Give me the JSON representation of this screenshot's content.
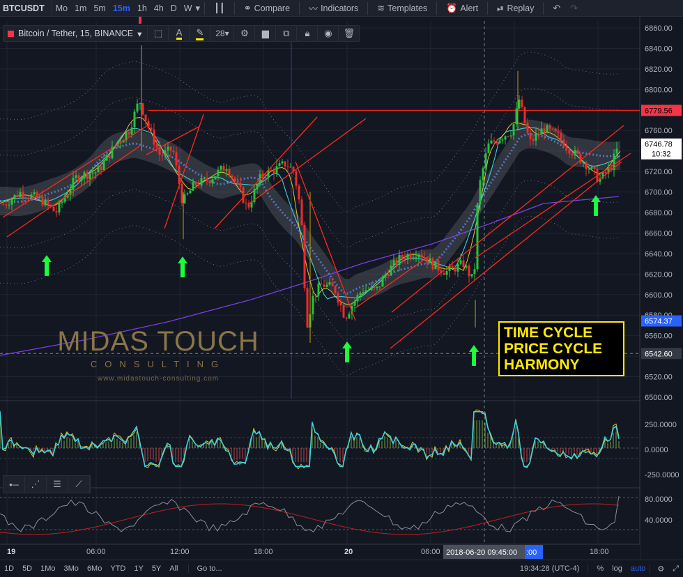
{
  "toolbar": {
    "symbol": "BTCUSDT",
    "intervals": [
      "Mo",
      "1m",
      "5m",
      "15m",
      "1h",
      "4h",
      "D",
      "W"
    ],
    "active_interval": "15m",
    "compare_label": "Compare",
    "indicators_label": "Indicators",
    "templates_label": "Templates",
    "alert_label": "Alert",
    "replay_label": "Replay"
  },
  "legend": {
    "title": "Bitcoin / Tether, 15, BINANCE",
    "font_size": "28"
  },
  "price_axis": {
    "ticks": [
      "6860.00",
      "6840.00",
      "6820.00",
      "6800.00",
      "6780.00",
      "6760.00",
      "6740.00",
      "6720.00",
      "6700.00",
      "6680.00",
      "6660.00",
      "6640.00",
      "6620.00",
      "6600.00",
      "6580.00",
      "6560.00",
      "6540.00",
      "6520.00",
      "6500.00"
    ],
    "labels": {
      "resistance": "6779.56",
      "last_price": "6746.78",
      "countdown": "10:32",
      "blue_level": "6574.37",
      "crosshair": "6542.60"
    }
  },
  "osc_axis": {
    "ticks": [
      "250.0000",
      "0.0000",
      "-250.0000"
    ]
  },
  "rsi_axis": {
    "ticks": [
      "80.0000",
      "40.0000"
    ]
  },
  "time_axis": {
    "labels": [
      "19",
      "06:00",
      "12:00",
      "18:00",
      "20",
      "06:00",
      "18:00"
    ],
    "crosshair_date": "2018-06-20 09:45:00",
    "crosshair_tail": ":00"
  },
  "annotation": {
    "line1": "TIME CYCLE",
    "line2": "PRICE CYCLE",
    "line3": "HARMONY"
  },
  "watermark": {
    "brand": "MIDAS TOUCH",
    "sub": "CONSULTING",
    "url": "www.midastouch-consulting.com"
  },
  "bottom": {
    "ranges": [
      "1D",
      "5D",
      "1Mo",
      "3Mo",
      "6Mo",
      "YTD",
      "1Y",
      "5Y",
      "All"
    ],
    "goto": "Go to...",
    "clock": "19:34:28 (UTC-4)",
    "percent": "%",
    "log": "log",
    "auto": "auto"
  },
  "colors": {
    "bg": "#131722",
    "up": "#26c23c",
    "down": "#ef2b2b",
    "channel": "#ff2a1a",
    "arrow": "#19ff3a",
    "accent": "#2962ff",
    "ema_yellow": "#e0c232",
    "ema_cyan": "#3fd0d8",
    "ma_purple": "#7b3fe4"
  }
}
